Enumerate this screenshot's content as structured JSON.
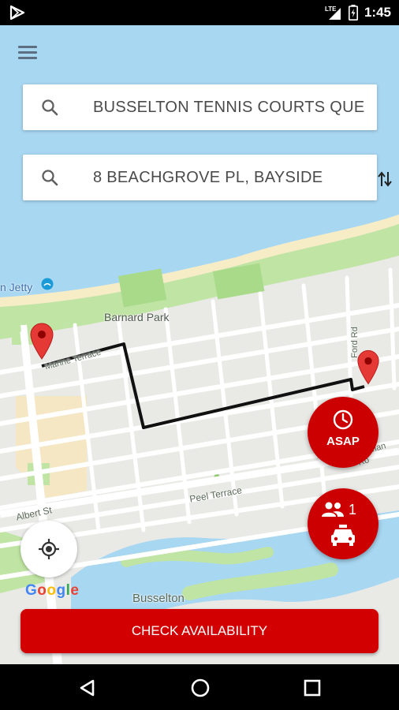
{
  "status_bar": {
    "time": "1:45",
    "network": "LTE",
    "icons": [
      "play-store-icon",
      "lte-signal-icon",
      "battery-icon"
    ]
  },
  "header": {
    "menu_icon": "hamburger-menu-icon"
  },
  "search": {
    "pickup": {
      "value": "BUSSELTON TENNIS COURTS QUE",
      "icon": "search-icon"
    },
    "dropoff": {
      "value": "8 BEACHGROVE PL, BAYSIDE",
      "icon": "search-icon"
    },
    "swap_icon": "swap-vertical-icon"
  },
  "map": {
    "labels": {
      "jetty": "n Jetty",
      "barnard_park": "Barnard Park",
      "marine_terrace": "Marine Terrace",
      "ford_rd": "Ford Rd",
      "layman_rd": "Layman Ro",
      "peel_terrace": "Peel Terrace",
      "albert_st": "Albert St",
      "busselton": "Busselton"
    },
    "attribution": "Google",
    "colors": {
      "water": "#a8d7f2",
      "park": "#bfe4a3",
      "road": "#ffffff",
      "route": "#111111",
      "pin": "#e53935"
    }
  },
  "fabs": {
    "asap": {
      "label": "ASAP",
      "icon": "clock-icon"
    },
    "passengers": {
      "count": "1",
      "icons": [
        "people-icon",
        "taxi-icon"
      ]
    },
    "locate_icon": "my-location-icon"
  },
  "actions": {
    "check_availability": "CHECK AVAILABILITY"
  },
  "nav": {
    "icons": [
      "back-triangle-icon",
      "home-circle-icon",
      "recents-square-icon"
    ]
  },
  "accent": "#d20000"
}
